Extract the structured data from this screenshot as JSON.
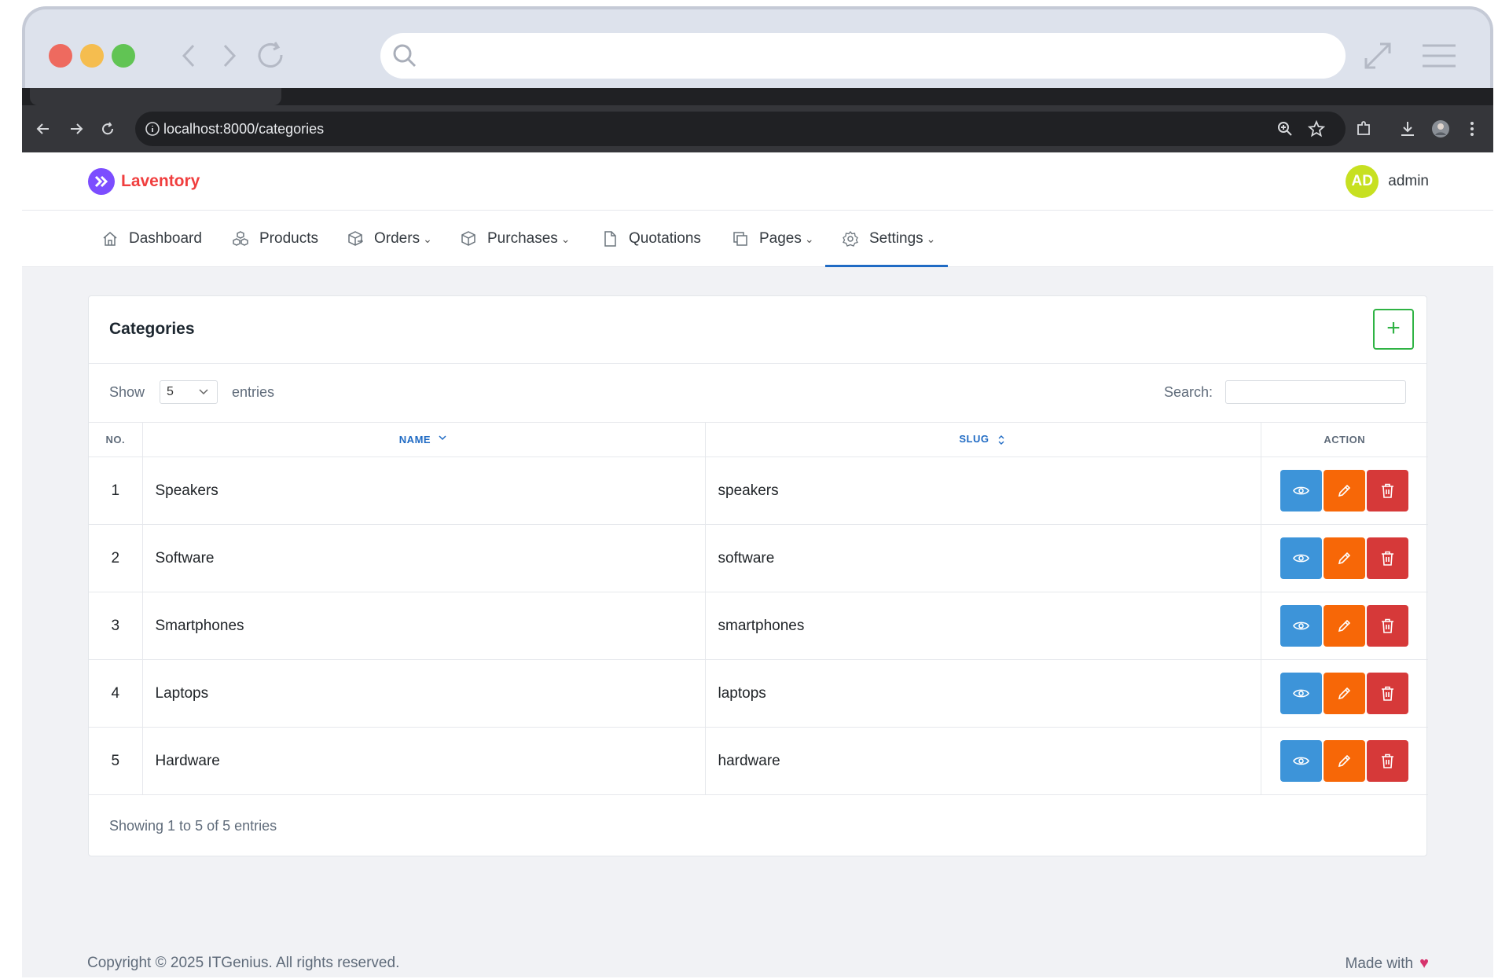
{
  "browser": {
    "url": "localhost:8000/categories"
  },
  "app": {
    "brand": "Laventory",
    "user": {
      "initials": "AD",
      "name": "admin"
    }
  },
  "nav": {
    "items": [
      {
        "label": "Dashboard",
        "icon": "home-icon"
      },
      {
        "label": "Products",
        "icon": "boxes-icon"
      },
      {
        "label": "Orders",
        "icon": "package-out-icon",
        "dropdown": true
      },
      {
        "label": "Purchases",
        "icon": "package-in-icon",
        "dropdown": true
      },
      {
        "label": "Quotations",
        "icon": "file-icon"
      },
      {
        "label": "Pages",
        "icon": "copy-icon",
        "dropdown": true
      },
      {
        "label": "Settings",
        "icon": "gear-icon",
        "dropdown": true,
        "active": true
      }
    ],
    "chevron": "⌄"
  },
  "card": {
    "title": "Categories",
    "add_label": "+",
    "show_label": "Show",
    "show_value": "5",
    "entries_label": "entries",
    "search_label": "Search:",
    "columns": {
      "no": "NO.",
      "name": "NAME",
      "slug": "SLUG",
      "action": "ACTION"
    },
    "rows": [
      {
        "no": "1",
        "name": "Speakers",
        "slug": "speakers"
      },
      {
        "no": "2",
        "name": "Software",
        "slug": "software"
      },
      {
        "no": "3",
        "name": "Smartphones",
        "slug": "smartphones"
      },
      {
        "no": "4",
        "name": "Laptops",
        "slug": "laptops"
      },
      {
        "no": "5",
        "name": "Hardware",
        "slug": "hardware"
      }
    ],
    "info": "Showing 1 to 5 of 5 entries"
  },
  "footer": {
    "copyright": "Copyright © 2025 ITGenius. All rights reserved.",
    "made_with": "Made with",
    "heart": "♥"
  },
  "colors": {
    "primary": "#206bc4",
    "view": "#3d94d9",
    "edit": "#f76707",
    "delete": "#d63939",
    "add": "#2fb344",
    "brand": "#f03e3e"
  }
}
